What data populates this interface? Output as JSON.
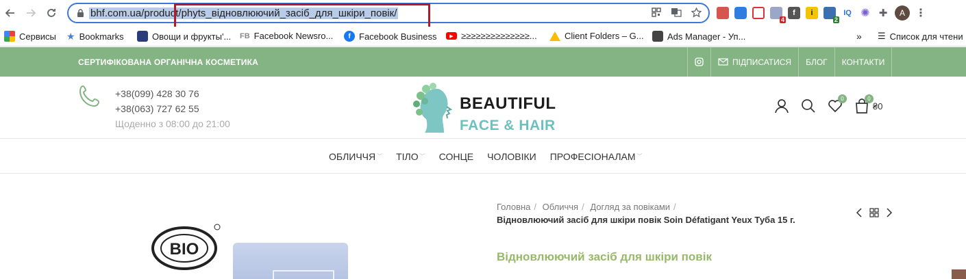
{
  "browser": {
    "url_text": "bhf.com.ua/product/phyts_відновлюючий_засіб_для_шкіри_повік/",
    "profile_initial": "A",
    "ext_badges": [
      "4",
      "2"
    ],
    "ext_labels": {
      "iq": "IQ"
    }
  },
  "bookmarks": [
    {
      "label": "Сервисы"
    },
    {
      "label": "Bookmarks"
    },
    {
      "label": "Овощи и фрукты'..."
    },
    {
      "label": "Facebook Newsro..."
    },
    {
      "label": "Facebook Business"
    },
    {
      "label": "≥≥≥≥≥≥≥≥≥≥≥≥≥≥..."
    },
    {
      "label": "Client Folders – G..."
    },
    {
      "label": "Ads Manager - Уп..."
    }
  ],
  "bookmarks_more": "»",
  "reading_list": "Список для чтени",
  "topbar": {
    "slogan": "СЕРТИФІКОВАНА ОРГАНІЧНА КОСМЕТИКА",
    "subscribe": "ПІДПИСАТИСЯ",
    "blog": "БЛОГ",
    "contacts": "КОНТАКТИ"
  },
  "header": {
    "phone1": "+38(099) 428 30 76",
    "phone2": "+38(063) 727 62 55",
    "hours": "Щоденно з 08:00 до 21:00",
    "brand_line1": "BEAUTIFUL",
    "brand_line2": "FACE & HAIR",
    "wishlist_count": "0",
    "cart_count": "0",
    "cart_total": "₴0"
  },
  "menu": [
    "ОБЛИЧЧЯ",
    "ТІЛО",
    "СОНЦЕ",
    "ЧОЛОВІКИ",
    "ПРОФЕСІОНАЛАМ"
  ],
  "breadcrumb": {
    "items": [
      "Головна",
      "Обличчя",
      "Догляд за повіками"
    ],
    "current": "Відновлюючий засіб для шкіри повік Soin Défatigant Yeux  Туба 15 г."
  },
  "product": {
    "title": "Відновлюючий засіб для шкіри повік"
  },
  "colors": {
    "accent_green": "#84b384",
    "brand_teal": "#6fc0bd",
    "title_green": "#98b86a",
    "annotation_red": "#b3192c"
  }
}
